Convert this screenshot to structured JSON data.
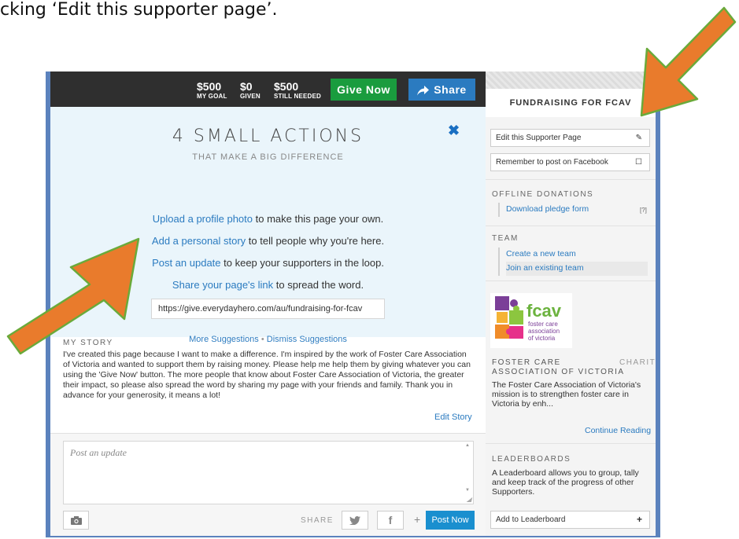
{
  "caption": "cking ‘Edit this supporter page’.",
  "topbar": {
    "stats": [
      {
        "value": "$500",
        "label": "MY GOAL"
      },
      {
        "value": "$0",
        "label": "GIVEN"
      },
      {
        "value": "$500",
        "label": "STILL NEEDED"
      }
    ],
    "give_label": "Give Now",
    "share_label": "Share"
  },
  "actions": {
    "title": "4 SMALL ACTIONS",
    "subtitle": "THAT MAKE A BIG DIFFERENCE",
    "lines": [
      {
        "link": "Upload a profile photo",
        "rest": " to make this page your own."
      },
      {
        "link": "Add a personal story",
        "rest": " to tell people why you're here."
      },
      {
        "link": "Post an update",
        "rest": " to keep your supporters in the loop."
      },
      {
        "link": "Share your page's link",
        "rest": " to spread the word."
      }
    ],
    "page_link": "https://give.everydayhero.com/au/fundraising-for-fcav",
    "more_suggestions": "More Suggestions",
    "separator": "•",
    "dismiss_suggestions": "Dismiss Suggestions"
  },
  "story": {
    "heading": "MY STORY",
    "text": "I've created this page because I want to make a difference. I'm inspired by the work of Foster Care Association of Victoria and wanted to support them by raising money. Please help me help them by giving whatever you can using the 'Give Now' button. The more people that know about Foster Care Association of Victoria, the greater their impact, so please also spread the word by sharing my page with your friends and family. Thank you in advance for your generosity, it means a lot!",
    "edit_label": "Edit Story"
  },
  "post": {
    "placeholder": "Post an update",
    "share_label": "SHARE",
    "twitter": "𝕥",
    "facebook": "f",
    "plus": "+",
    "post_now_label": "Post Now"
  },
  "sidebar": {
    "page_title": "FUNDRAISING FOR FCAV",
    "edit_page": "Edit this Supporter Page",
    "facebook_reminder": "Remember to post on Facebook",
    "offline_heading": "OFFLINE DONATIONS",
    "pledge_link": "Download pledge form",
    "pledge_help": "[?]",
    "team_heading": "TEAM",
    "create_team": "Create a new team",
    "join_team": "Join an existing team",
    "logo_text": "fcav",
    "logo_sub": [
      "foster care",
      "association",
      "of victoria"
    ],
    "charity_name_1": "FOSTER CARE",
    "charity_tag": "CHARITY",
    "charity_name_2": "ASSOCIATION OF VICTORIA",
    "charity_desc": "The Foster Care Association of Victoria's mission is to strengthen foster care in Victoria by enh...",
    "continue_reading": "Continue Reading",
    "leaderboards_heading": "LEADERBOARDS",
    "leaderboards_desc": "A Leaderboard allows you to group, tally and keep track of the progress of other Supporters.",
    "add_leaderboard": "Add to Leaderboard",
    "add_icon": "+"
  },
  "colors": {
    "frame": "#5b82bd",
    "give_green": "#1a9c3e",
    "share_blue": "#2b7bc0",
    "link_blue": "#2b7bc0",
    "arrow_orange": "#e97b2c",
    "arrow_outline": "#6aaa3a"
  }
}
